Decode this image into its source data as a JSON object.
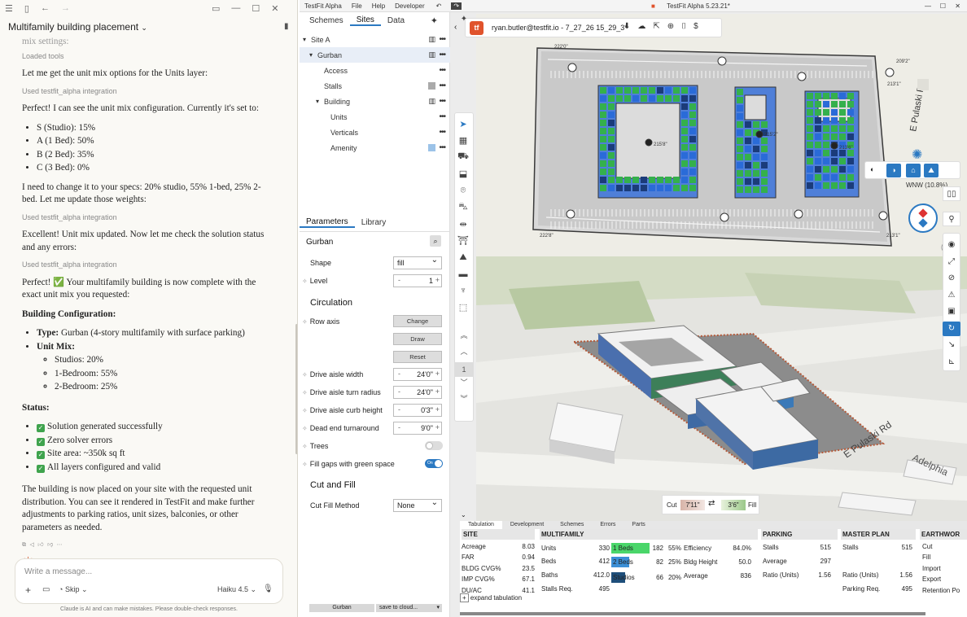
{
  "chat": {
    "title": "Multifamily building placement",
    "messages": {
      "cut_line": "mix settings:",
      "loaded_tools": "Loaded tools",
      "p1": "Let me get the unit mix options for the Units layer:",
      "tool1": "Used testfit_alpha integration",
      "p2": "Perfect! I can see the unit mix configuration. Currently it's set to:",
      "current_mix": [
        "S (Studio): 15%",
        "A (1 Bed): 50%",
        "B (2 Bed): 35%",
        "C (3 Bed): 0%"
      ],
      "p3": "I need to change it to your specs: 20% studio, 55% 1-bed, 25% 2-bed. Let me update those weights:",
      "tool2": "Used testfit_alpha integration",
      "p4": "Excellent! Unit mix updated. Now let me check the solution status and any errors:",
      "tool3": "Used testfit_alpha integration",
      "p5": "Perfect! ✅ Your multifamily building is now complete with the exact unit mix you requested:",
      "config_heading": "Building Configuration:",
      "type_label": "Type:",
      "type_value": " Gurban (4-story multifamily with surface parking)",
      "unit_mix_label": "Unit Mix:",
      "unit_mix": [
        "Studios: 20%",
        "1-Bedroom: 55%",
        "2-Bedroom: 25%"
      ],
      "status_heading": "Status:",
      "status": [
        "Solution generated successfully",
        "Zero solver errors",
        "Site area: ~350k sq ft",
        "All layers configured and valid"
      ],
      "p6": "The building is now placed on your site with the requested unit distribution. You can see it rendered in TestFit and make further adjustments to parking ratios, unit sizes, balconies, or other parameters as needed."
    },
    "input_placeholder": "Write a message...",
    "skip_label": "Skip",
    "model_label": "Haiku 4.5",
    "footer": "Claude is AI and can make mistakes. Please double-check responses."
  },
  "app": {
    "window_title": "TestFit Alpha 5.23.21*",
    "menu": [
      "TestFit Alpha",
      "File",
      "Help",
      "Developer"
    ],
    "top_tabs": [
      "Schemes",
      "Sites",
      "Data"
    ],
    "active_top_tab": "Sites",
    "user_file": "ryan.butler@testfit.io - 7_27_26 15_29_3*",
    "tree": [
      {
        "label": "Site A",
        "indent": 0,
        "arrow": "▾"
      },
      {
        "label": "Gurban",
        "indent": 1,
        "arrow": "▾"
      },
      {
        "label": "Access",
        "indent": 2,
        "arrow": ""
      },
      {
        "label": "Stalls",
        "indent": 2,
        "arrow": ""
      },
      {
        "label": "Building",
        "indent": 2,
        "arrow": "▾"
      },
      {
        "label": "Units",
        "indent": 3,
        "arrow": ""
      },
      {
        "label": "Verticals",
        "indent": 3,
        "arrow": ""
      },
      {
        "label": "Amenity",
        "indent": 3,
        "arrow": ""
      }
    ],
    "param_tabs": [
      "Parameters",
      "Library"
    ],
    "selected_object": "Gurban",
    "shape_label": "Shape",
    "shape_value": "fill",
    "level_label": "Level",
    "level_value": "1",
    "circulation_heading": "Circulation",
    "row_axis_label": "Row axis",
    "change_label": "Change",
    "draw_label": "Draw",
    "reset_label": "Reset",
    "drive_aisle_width_label": "Drive aisle width",
    "drive_aisle_width": "24'0\"",
    "turn_radius_label": "Drive aisle turn radius",
    "turn_radius": "24'0\"",
    "curb_height_label": "Drive aisle curb height",
    "curb_height": "0'3\"",
    "dead_end_label": "Dead end turnaround",
    "dead_end": "9'0\"",
    "trees_label": "Trees",
    "green_label": "Fill gaps with green space",
    "toggle_on": "On",
    "cut_fill_heading": "Cut and Fill",
    "cut_fill_method_label": "Cut Fill Method",
    "cut_fill_method": "None",
    "bottom_gurban": "Gurban",
    "save_cloud": "save to cloud...",
    "view_3d": "3D",
    "compass_label": "WNW (10.8%)",
    "road_label": "E Pulaski Rd",
    "road_label_3d": "E Pulaski Rd",
    "place_label": "Adelphia",
    "cut_label": "Cut",
    "cut_value": "7'11\"",
    "fill_value": "3'6\"",
    "fill_label": "Fill",
    "dims": [
      "222'0\"",
      "209'2\"",
      "213'1\"",
      "215'8\"",
      "215'2\"",
      "213'6\"",
      "222'8\"",
      "213'1\""
    ],
    "page_indicator": "1"
  },
  "tabulation": {
    "tabs": [
      "Tabulation",
      "Development",
      "Schemes",
      "Errors",
      "Parts"
    ],
    "site": {
      "heading": "SITE",
      "rows": [
        [
          "Acreage",
          "8.03"
        ],
        [
          "FAR",
          "0.94"
        ],
        [
          "BLDG CVG%",
          "23.5"
        ],
        [
          "IMP CVG%",
          "67.1"
        ],
        [
          "DU/AC",
          "41.1"
        ]
      ]
    },
    "multifamily": {
      "heading": "MULTIFAMILY",
      "rows": [
        [
          "Units",
          "330"
        ],
        [
          "Beds",
          "412"
        ],
        [
          "Baths",
          "412.0"
        ],
        [
          "Stalls Req.",
          "495"
        ]
      ],
      "mix": [
        [
          "1 Beds",
          "182",
          "55%"
        ],
        [
          "2 Beds",
          "82",
          "25%"
        ],
        [
          "Studios",
          "66",
          "20%"
        ]
      ],
      "mix_fraction": [
        0.55,
        0.25,
        0.2
      ],
      "stats": [
        [
          "Efficiency",
          "84.0%"
        ],
        [
          "Bldg Height",
          "50.0"
        ],
        [
          "Average",
          "836"
        ]
      ]
    },
    "parking": {
      "heading": "PARKING",
      "rows": [
        [
          "Stalls",
          "515"
        ],
        [
          "Average",
          "297"
        ],
        [
          "Ratio (Units)",
          "1.56"
        ]
      ]
    },
    "master": {
      "heading": "MASTER PLAN",
      "rows": [
        [
          "Stalls",
          "515"
        ],
        [
          "",
          ""
        ],
        [
          "Ratio (Units)",
          "1.56"
        ],
        [
          "Parking Req.",
          "495"
        ]
      ]
    },
    "earthwork": {
      "heading": "EARTHWOR",
      "rows": [
        "Cut",
        "Fill",
        "Import",
        "Export",
        "Retention Po"
      ]
    },
    "expand_label": "expand tabulation"
  }
}
